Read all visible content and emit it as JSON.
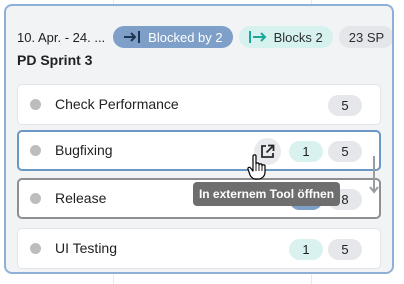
{
  "sprint": {
    "date_range": "10. Apr. - 24. ...",
    "name": "PD Sprint 3",
    "blocked_by_label": "Blocked by 2",
    "blocks_label": "Blocks 2",
    "story_points": "23 SP"
  },
  "tasks": [
    {
      "name": "Check Performance",
      "dependencies": "",
      "points": "5"
    },
    {
      "name": "Bugfixing",
      "dependencies": "1",
      "points": "5"
    },
    {
      "name": "Release",
      "dependencies": "",
      "points": "8"
    },
    {
      "name": "UI Testing",
      "dependencies": "1",
      "points": "5"
    }
  ],
  "tooltip": {
    "text": "In externem Tool öffnen"
  },
  "icons": {
    "blocked": "arrow-to-bar-icon",
    "blocks": "bar-to-arrow-icon",
    "external": "open-external-icon",
    "cursor": "hand-pointer-icon"
  },
  "colors": {
    "card_border": "#8fb0d6",
    "card_bg": "#f1f3f5",
    "blocked_chip": "#7e9fc7",
    "blocks_chip": "#d7f1ef",
    "selected_border": "#6b97c4",
    "tooltip_bg": "#6e6e6e"
  }
}
